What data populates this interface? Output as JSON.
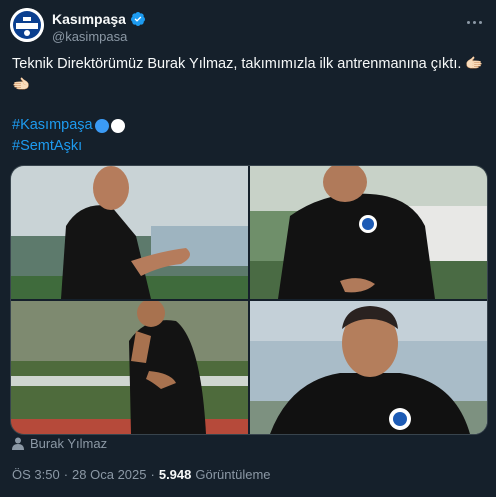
{
  "author": {
    "display_name": "Kasımpaşa",
    "handle": "@kasimpasa",
    "verified": true
  },
  "tweet": {
    "text": "Teknik Direktörümüz Burak Yılmaz, takımımızla ilk antrenmanına çıktı. 🫱🏻🫲🏻",
    "hashtags": [
      "#Kasımpaşa",
      "#SemtAşkı"
    ],
    "hashtag_emoji_colors": [
      "#3b9bf5",
      "#ffffff"
    ]
  },
  "media": {
    "photos": [
      "training-photo-1",
      "training-photo-2",
      "training-photo-3",
      "training-photo-4"
    ]
  },
  "tagged_user": "Burak Yılmaz",
  "meta": {
    "time": "ÖS 3:50",
    "separator": "·",
    "date": "28 Oca 2025",
    "views_count": "5.948",
    "views_label": "Görüntüleme"
  },
  "colors": {
    "background": "#15202b",
    "text": "#f7f9f9",
    "secondary": "#8b98a5",
    "accent": "#1d9bf0"
  }
}
